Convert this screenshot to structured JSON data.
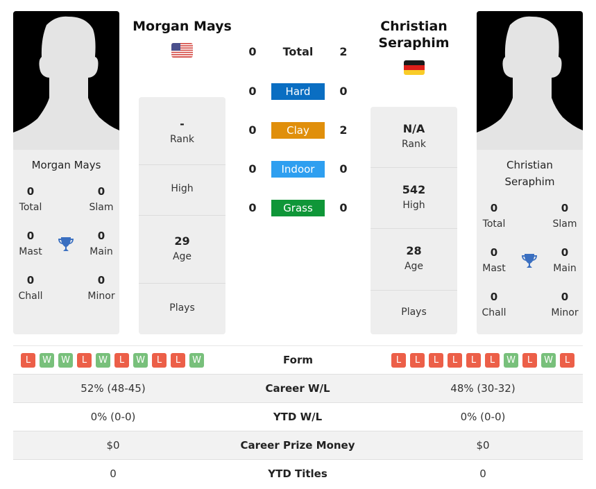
{
  "players": {
    "left": {
      "name": "Morgan Mays",
      "card_name": "Morgan Mays",
      "country_flag": "USA",
      "titles": {
        "total": {
          "value": "0",
          "label": "Total"
        },
        "slam": {
          "value": "0",
          "label": "Slam"
        },
        "mast": {
          "value": "0",
          "label": "Mast"
        },
        "main": {
          "value": "0",
          "label": "Main"
        },
        "chall": {
          "value": "0",
          "label": "Chall"
        },
        "minor": {
          "value": "0",
          "label": "Minor"
        }
      },
      "info": {
        "rank": {
          "value": "-",
          "label": "Rank"
        },
        "high": {
          "value": "",
          "label": "High"
        },
        "age": {
          "value": "29",
          "label": "Age"
        },
        "plays": {
          "value": "",
          "label": "Plays"
        }
      },
      "form": [
        "L",
        "W",
        "W",
        "L",
        "W",
        "L",
        "W",
        "L",
        "L",
        "W"
      ]
    },
    "right": {
      "name": "Christian Seraphim",
      "name_line1": "Christian",
      "name_line2": "Seraphim",
      "card_name_line1": "Christian",
      "card_name_line2": "Seraphim",
      "country_flag": "Germany",
      "titles": {
        "total": {
          "value": "0",
          "label": "Total"
        },
        "slam": {
          "value": "0",
          "label": "Slam"
        },
        "mast": {
          "value": "0",
          "label": "Mast"
        },
        "main": {
          "value": "0",
          "label": "Main"
        },
        "chall": {
          "value": "0",
          "label": "Chall"
        },
        "minor": {
          "value": "0",
          "label": "Minor"
        }
      },
      "info": {
        "rank": {
          "value": "N/A",
          "label": "Rank"
        },
        "high": {
          "value": "542",
          "label": "High"
        },
        "age": {
          "value": "28",
          "label": "Age"
        },
        "plays": {
          "value": "",
          "label": "Plays"
        }
      },
      "form": [
        "L",
        "L",
        "L",
        "L",
        "L",
        "L",
        "W",
        "L",
        "W",
        "L"
      ]
    }
  },
  "h2h": [
    {
      "surface": "Total",
      "left": "0",
      "right": "2",
      "color": ""
    },
    {
      "surface": "Hard",
      "left": "0",
      "right": "0",
      "color": "#0a6ec2"
    },
    {
      "surface": "Clay",
      "left": "0",
      "right": "2",
      "color": "#e08f0b"
    },
    {
      "surface": "Indoor",
      "left": "0",
      "right": "0",
      "color": "#2e9ff0"
    },
    {
      "surface": "Grass",
      "left": "0",
      "right": "0",
      "color": "#0f9638"
    }
  ],
  "form_label": "Form",
  "stats": [
    {
      "label": "Career W/L",
      "left": "52% (48-45)",
      "right": "48% (30-32)"
    },
    {
      "label": "YTD W/L",
      "left": "0% (0-0)",
      "right": "0% (0-0)"
    },
    {
      "label": "Career Prize Money",
      "left": "$0",
      "right": "$0"
    },
    {
      "label": "YTD Titles",
      "left": "0",
      "right": "0"
    }
  ],
  "colors": {
    "loss": "#ec5f48",
    "win": "#78c07b",
    "trophy": "#3a6fc0"
  }
}
